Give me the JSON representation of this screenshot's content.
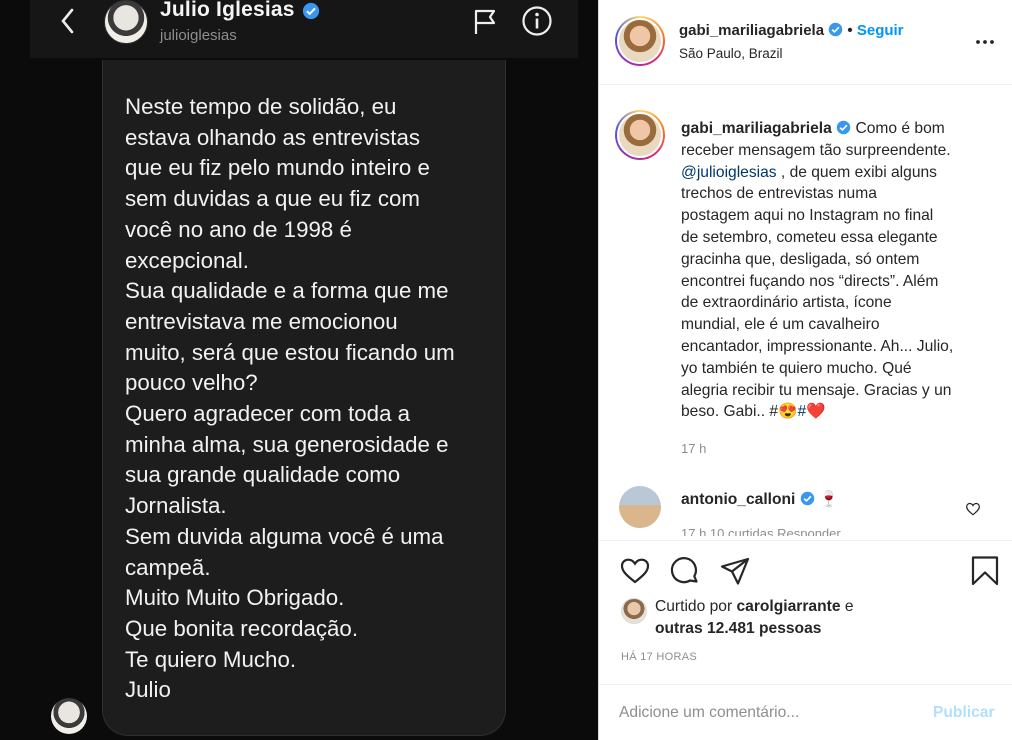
{
  "dm": {
    "name": "Julio Iglesias",
    "handle": "julioiglesias",
    "message_lines": [
      "Neste tempo de solidão, eu",
      "estava olhando as entrevistas",
      "que eu fiz pelo mundo inteiro e",
      "sem duvidas a que eu fiz com",
      "você no ano de 1998 é",
      "excepcional.",
      "Sua qualidade e a forma que me",
      "entrevistava me emocionou",
      "muito, será que estou ficando um",
      "pouco velho?",
      "Quero agradecer com toda a",
      "minha alma, sua generosidade e",
      "sua grande qualidade como",
      "Jornalista.",
      "Sem duvida alguma você é uma",
      "campeã.",
      "Muito Muito Obrigado.",
      "Que bonita recordação.",
      "Te quiero Mucho.",
      "Julio"
    ]
  },
  "post": {
    "username": "gabi_mariliagabriela",
    "follow_label": "Seguir",
    "location": "São Paulo, Brazil",
    "caption": {
      "username": "gabi_mariliagabriela",
      "line1_text": "Como é bom",
      "lines": [
        "receber mensagem tão surpreendente.",
        "@julioiglesias",
        ", de quem exibi alguns",
        "trechos de entrevistas numa",
        "postagem aqui no Instagram no final",
        "de setembro, cometeu essa elegante",
        "gracinha que, desligada, só ontem",
        "encontrei fuçando nos “directs”. Além",
        "de extraordinário artista, ícone",
        "mundial, ele é um cavalheiro",
        "encantador, impressionante. Ah... Julio,",
        "yo también te quiero mucho. Qué",
        "alegria recibir tu mensaje. Gracias y un",
        "beso. Gabi.. #",
        "😍",
        "#",
        "❤️"
      ],
      "time": "17 h"
    },
    "comment": {
      "username": "antonio_calloni",
      "emoji": "🍷",
      "meta": "17 h   10 curtidas   Responder"
    },
    "likes": {
      "prefix": "Curtido por",
      "user": "carolgiarrante",
      "joiner": "e",
      "others": "outras 12.481 pessoas"
    },
    "time_ago": "HÁ 17 HORAS",
    "comment_placeholder": "Adicione um comentário...",
    "publish_label": "Publicar"
  },
  "colors": {
    "accent": "#0095f6",
    "verified": "#3897f0",
    "dm_background": "#0b0b0b",
    "bubble": "#1d1d1d"
  },
  "icons": [
    "back-chevron-icon",
    "verified-icon",
    "flag-icon",
    "info-icon",
    "more-icon",
    "heart-icon",
    "comment-icon",
    "share-icon",
    "bookmark-icon"
  ]
}
